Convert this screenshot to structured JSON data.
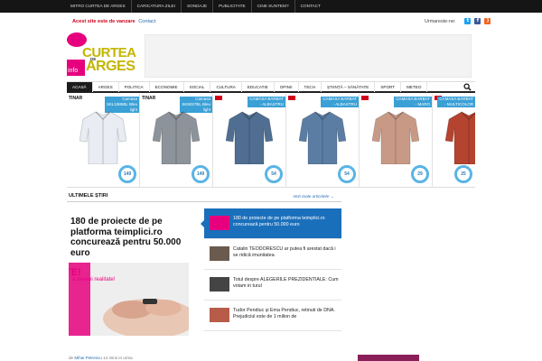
{
  "topbar": {
    "items": [
      "MITRO CURTEA DE ARGES",
      "CARICATURA ZILEI",
      "SONDAJE",
      "PUBLICITATE",
      "CINE SUNTEM?",
      "CONTACT"
    ]
  },
  "sale": {
    "text": "Acest site este de vanzare",
    "link": "Contact"
  },
  "follow": {
    "label": "Urmareste-ne:",
    "icons": [
      "twitter-icon",
      "facebook-icon",
      "rss-icon"
    ]
  },
  "logo": {
    "curtea": "CURTEA",
    "de": "DE",
    "arges": "ARGES",
    "info": "info"
  },
  "nav": {
    "items": [
      "ACASĂ",
      "ARGES",
      "POLITICA",
      "ECONOMIE",
      "SOCIAL",
      "CULTURA",
      "EDUCATIE",
      "OPINII",
      "TECH",
      "ȘTIINȚĂ – SĂNĂTATE",
      "SPORT",
      "METEO"
    ],
    "active": 0
  },
  "products": [
    {
      "brand": "TINAR",
      "tag": "Camasa\nSKL1986BL Bleu\nlight",
      "price": "149",
      "shirt_color": "#e9edf3",
      "sale": false
    },
    {
      "brand": "TINAR",
      "tag": "Camasa\nSK5027BL Bleu\nlight",
      "price": "149",
      "shirt_color": "#8d939a",
      "sale": false
    },
    {
      "brand": "",
      "tag": "CAMASA BARBAT\n- ALBASTRU",
      "price": "54",
      "shirt_color": "#4f6e91",
      "sale": true
    },
    {
      "brand": "",
      "tag": "CAMASA BARBAT\n- ALBASTRU",
      "price": "54",
      "shirt_color": "#5b7da3",
      "sale": true
    },
    {
      "brand": "",
      "tag": "CAMASA BARBAT\n- MARO",
      "price": "29",
      "shirt_color": "#c89a86",
      "sale": true
    },
    {
      "brand": "",
      "tag": "CAMASA BARBAT\n- MULTICOLOR",
      "price": "25",
      "shirt_color": "#b4432f",
      "sale": true
    }
  ],
  "section": {
    "title": "ULTIMELE ȘTIRI",
    "link": "Vezi toate articolele →"
  },
  "featured": {
    "title": "180 de proiecte de pe platforma teimplici.ro concurează pentru 50.000 euro",
    "img_big": "TE!",
    "img_text": "ă deveni realitate!",
    "author": "Mihai Petrescu",
    "time": "14 mins in urma"
  },
  "news": [
    {
      "text": "180 de proiecte de pe platforma teimplici.ro concurează pentru 50.000 euro",
      "thumb": "#e6007e",
      "active": true
    },
    {
      "text": "Catalin TEODORESCU ar putea fi arestat dacă i se ridică imunitatea",
      "thumb": "#6b5a4e",
      "active": false
    },
    {
      "text": "Totul despre ALEGERILE PREZIDENTIALE: Cum votam in turul",
      "thumb": "#444444",
      "active": false
    },
    {
      "text": "Tudor Pendiuc și Ema Pendiuc, retinuti de DNA. Prejudiciul este de 1 milion de",
      "thumb": "#b85c4a",
      "active": false
    }
  ],
  "colors": {
    "accent": "#1a6fbb",
    "brand_pink": "#e6007e",
    "brand_gold": "#c4b500",
    "sale_red": "#d0021b",
    "price_blue": "#5ab4e5"
  }
}
